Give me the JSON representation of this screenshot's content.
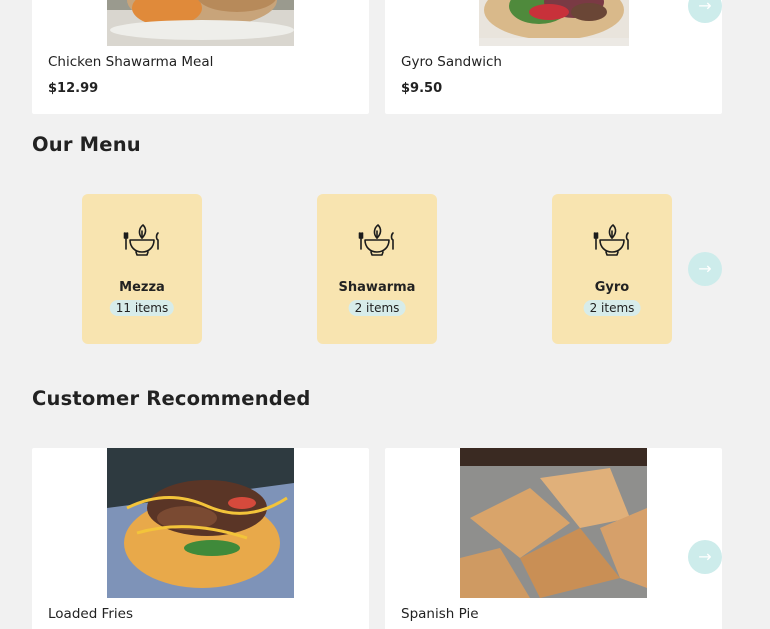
{
  "featured": {
    "items": [
      {
        "name": "Chicken Shawarma Meal",
        "price": "$12.99"
      },
      {
        "name": "Gyro Sandwich",
        "price": "$9.50"
      }
    ],
    "next_icon": "arrow-right-icon"
  },
  "menu": {
    "title": "Our Menu",
    "categories": [
      {
        "name": "Mezza",
        "count": "11 items",
        "icon": "food-bowl-icon"
      },
      {
        "name": "Shawarma",
        "count": "2 items",
        "icon": "food-bowl-icon"
      },
      {
        "name": "Gyro",
        "count": "2 items",
        "icon": "food-bowl-icon"
      }
    ],
    "next_icon": "arrow-right-icon"
  },
  "recommended": {
    "title": "Customer Recommended",
    "items": [
      {
        "name": "Loaded Fries"
      },
      {
        "name": "Spanish Pie"
      }
    ],
    "next_icon": "arrow-right-icon"
  },
  "colors": {
    "background": "#f1f1f1",
    "category_tile": "#f8e4b0",
    "count_badge": "#d7ecea",
    "next_button": "#cdeceb"
  }
}
